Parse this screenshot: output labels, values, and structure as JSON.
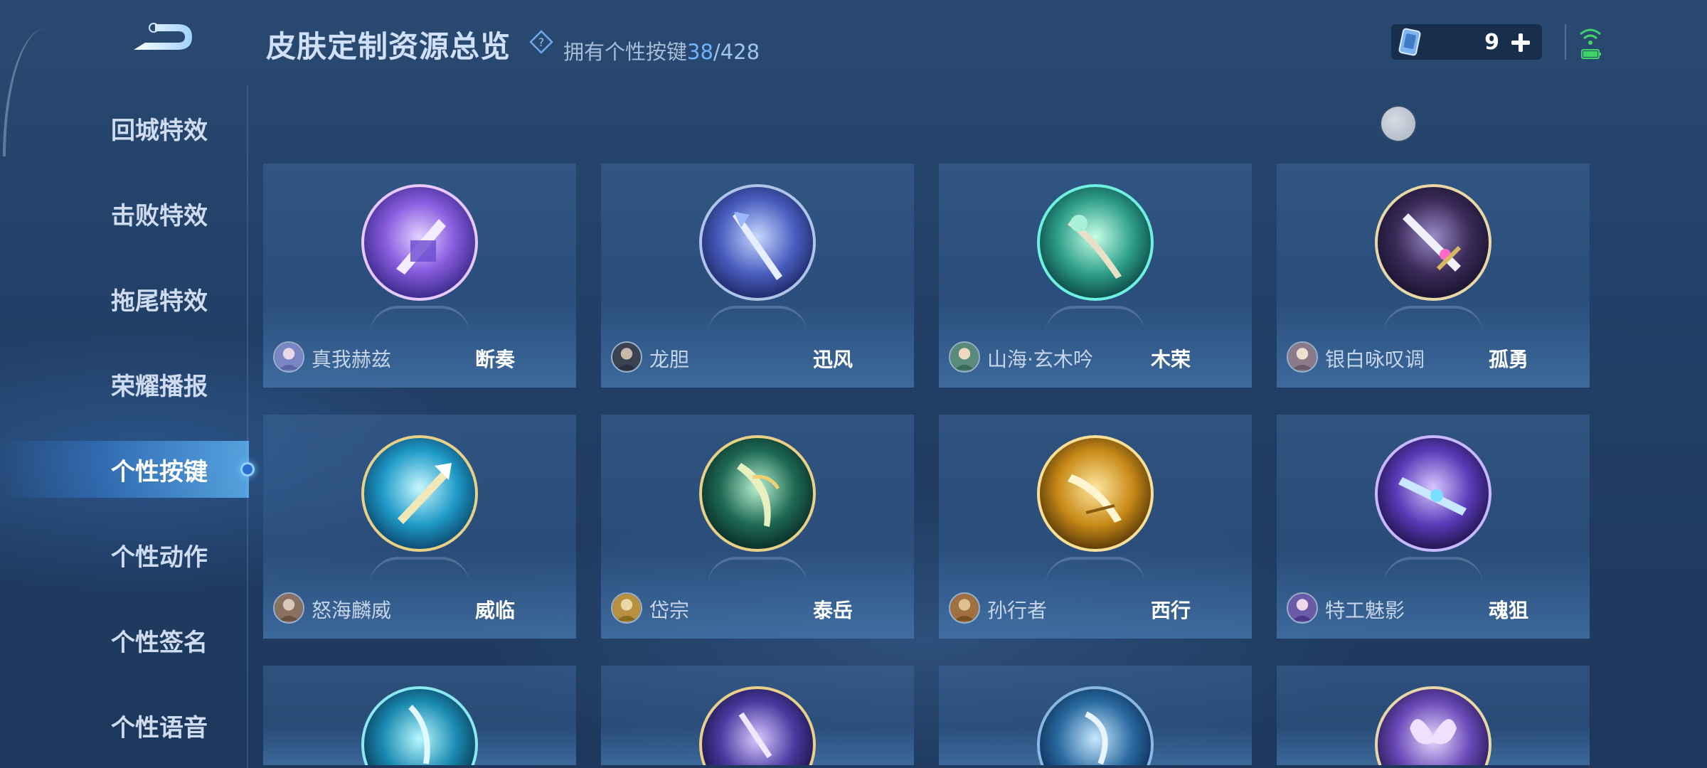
{
  "header": {
    "title": "皮肤定制资源总览",
    "owned_label": "拥有个性按键",
    "owned_count": "38",
    "owned_sep": "/",
    "owned_total": "428",
    "currency_count": "9"
  },
  "sidebar": {
    "items": [
      {
        "label": "回城特效"
      },
      {
        "label": "击败特效"
      },
      {
        "label": "拖尾特效"
      },
      {
        "label": "荣耀播报"
      },
      {
        "label": "个性按键"
      },
      {
        "label": "个性动作"
      },
      {
        "label": "个性签名"
      },
      {
        "label": "个性语音"
      }
    ],
    "active_index": 4
  },
  "cards": [
    {
      "hero": "真我赫兹",
      "skin": "断奏",
      "theme": "purple"
    },
    {
      "hero": "龙胆",
      "skin": "迅风",
      "theme": "blue"
    },
    {
      "hero": "山海·玄木吟",
      "skin": "木荣",
      "theme": "teal"
    },
    {
      "hero": "银白咏叹调",
      "skin": "孤勇",
      "theme": "gold-dark"
    },
    {
      "hero": "怒海麟威",
      "skin": "威临",
      "theme": "cyan"
    },
    {
      "hero": "岱宗",
      "skin": "泰岳",
      "theme": "green"
    },
    {
      "hero": "孙行者",
      "skin": "西行",
      "theme": "gold"
    },
    {
      "hero": "特工魅影",
      "skin": "魂狙",
      "theme": "violet"
    },
    {
      "hero": "",
      "skin": "",
      "theme": "cyan"
    },
    {
      "hero": "",
      "skin": "",
      "theme": "violet"
    },
    {
      "hero": "",
      "skin": "",
      "theme": "blue"
    },
    {
      "hero": "",
      "skin": "",
      "theme": "violet"
    }
  ],
  "colors": {
    "accent": "#6fb2ff",
    "background": "#224068",
    "active_glow": "#64beff"
  }
}
